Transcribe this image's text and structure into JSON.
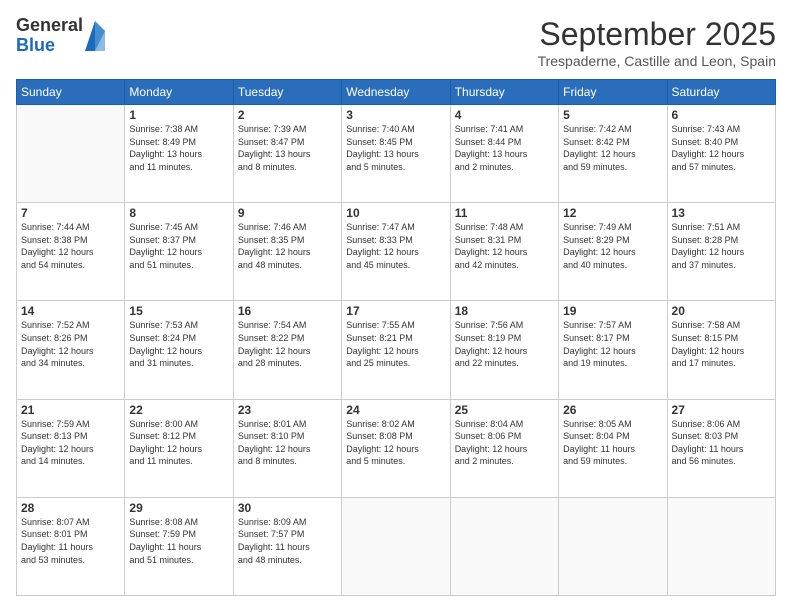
{
  "logo": {
    "general": "General",
    "blue": "Blue"
  },
  "title": {
    "month": "September 2025",
    "location": "Trespaderne, Castille and Leon, Spain"
  },
  "headers": [
    "Sunday",
    "Monday",
    "Tuesday",
    "Wednesday",
    "Thursday",
    "Friday",
    "Saturday"
  ],
  "weeks": [
    [
      {
        "day": "",
        "info": ""
      },
      {
        "day": "1",
        "info": "Sunrise: 7:38 AM\nSunset: 8:49 PM\nDaylight: 13 hours\nand 11 minutes."
      },
      {
        "day": "2",
        "info": "Sunrise: 7:39 AM\nSunset: 8:47 PM\nDaylight: 13 hours\nand 8 minutes."
      },
      {
        "day": "3",
        "info": "Sunrise: 7:40 AM\nSunset: 8:45 PM\nDaylight: 13 hours\nand 5 minutes."
      },
      {
        "day": "4",
        "info": "Sunrise: 7:41 AM\nSunset: 8:44 PM\nDaylight: 13 hours\nand 2 minutes."
      },
      {
        "day": "5",
        "info": "Sunrise: 7:42 AM\nSunset: 8:42 PM\nDaylight: 12 hours\nand 59 minutes."
      },
      {
        "day": "6",
        "info": "Sunrise: 7:43 AM\nSunset: 8:40 PM\nDaylight: 12 hours\nand 57 minutes."
      }
    ],
    [
      {
        "day": "7",
        "info": "Sunrise: 7:44 AM\nSunset: 8:38 PM\nDaylight: 12 hours\nand 54 minutes."
      },
      {
        "day": "8",
        "info": "Sunrise: 7:45 AM\nSunset: 8:37 PM\nDaylight: 12 hours\nand 51 minutes."
      },
      {
        "day": "9",
        "info": "Sunrise: 7:46 AM\nSunset: 8:35 PM\nDaylight: 12 hours\nand 48 minutes."
      },
      {
        "day": "10",
        "info": "Sunrise: 7:47 AM\nSunset: 8:33 PM\nDaylight: 12 hours\nand 45 minutes."
      },
      {
        "day": "11",
        "info": "Sunrise: 7:48 AM\nSunset: 8:31 PM\nDaylight: 12 hours\nand 42 minutes."
      },
      {
        "day": "12",
        "info": "Sunrise: 7:49 AM\nSunset: 8:29 PM\nDaylight: 12 hours\nand 40 minutes."
      },
      {
        "day": "13",
        "info": "Sunrise: 7:51 AM\nSunset: 8:28 PM\nDaylight: 12 hours\nand 37 minutes."
      }
    ],
    [
      {
        "day": "14",
        "info": "Sunrise: 7:52 AM\nSunset: 8:26 PM\nDaylight: 12 hours\nand 34 minutes."
      },
      {
        "day": "15",
        "info": "Sunrise: 7:53 AM\nSunset: 8:24 PM\nDaylight: 12 hours\nand 31 minutes."
      },
      {
        "day": "16",
        "info": "Sunrise: 7:54 AM\nSunset: 8:22 PM\nDaylight: 12 hours\nand 28 minutes."
      },
      {
        "day": "17",
        "info": "Sunrise: 7:55 AM\nSunset: 8:21 PM\nDaylight: 12 hours\nand 25 minutes."
      },
      {
        "day": "18",
        "info": "Sunrise: 7:56 AM\nSunset: 8:19 PM\nDaylight: 12 hours\nand 22 minutes."
      },
      {
        "day": "19",
        "info": "Sunrise: 7:57 AM\nSunset: 8:17 PM\nDaylight: 12 hours\nand 19 minutes."
      },
      {
        "day": "20",
        "info": "Sunrise: 7:58 AM\nSunset: 8:15 PM\nDaylight: 12 hours\nand 17 minutes."
      }
    ],
    [
      {
        "day": "21",
        "info": "Sunrise: 7:59 AM\nSunset: 8:13 PM\nDaylight: 12 hours\nand 14 minutes."
      },
      {
        "day": "22",
        "info": "Sunrise: 8:00 AM\nSunset: 8:12 PM\nDaylight: 12 hours\nand 11 minutes."
      },
      {
        "day": "23",
        "info": "Sunrise: 8:01 AM\nSunset: 8:10 PM\nDaylight: 12 hours\nand 8 minutes."
      },
      {
        "day": "24",
        "info": "Sunrise: 8:02 AM\nSunset: 8:08 PM\nDaylight: 12 hours\nand 5 minutes."
      },
      {
        "day": "25",
        "info": "Sunrise: 8:04 AM\nSunset: 8:06 PM\nDaylight: 12 hours\nand 2 minutes."
      },
      {
        "day": "26",
        "info": "Sunrise: 8:05 AM\nSunset: 8:04 PM\nDaylight: 11 hours\nand 59 minutes."
      },
      {
        "day": "27",
        "info": "Sunrise: 8:06 AM\nSunset: 8:03 PM\nDaylight: 11 hours\nand 56 minutes."
      }
    ],
    [
      {
        "day": "28",
        "info": "Sunrise: 8:07 AM\nSunset: 8:01 PM\nDaylight: 11 hours\nand 53 minutes."
      },
      {
        "day": "29",
        "info": "Sunrise: 8:08 AM\nSunset: 7:59 PM\nDaylight: 11 hours\nand 51 minutes."
      },
      {
        "day": "30",
        "info": "Sunrise: 8:09 AM\nSunset: 7:57 PM\nDaylight: 11 hours\nand 48 minutes."
      },
      {
        "day": "",
        "info": ""
      },
      {
        "day": "",
        "info": ""
      },
      {
        "day": "",
        "info": ""
      },
      {
        "day": "",
        "info": ""
      }
    ]
  ]
}
